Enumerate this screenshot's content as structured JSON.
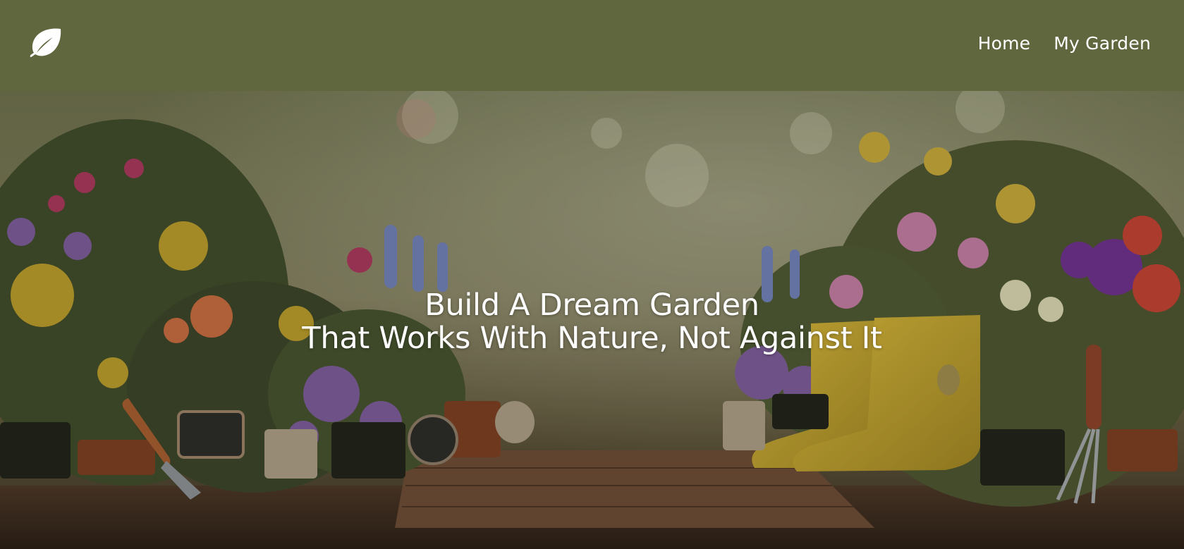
{
  "header": {
    "logo_icon": "leaf-icon",
    "background": "#60663e",
    "nav": [
      {
        "label": "Home"
      },
      {
        "label": "My Garden"
      }
    ]
  },
  "hero": {
    "line1": "Build A Dream Garden",
    "line2": "That Works With Nature, Not Against It",
    "image_description_icon": "garden-photo"
  }
}
